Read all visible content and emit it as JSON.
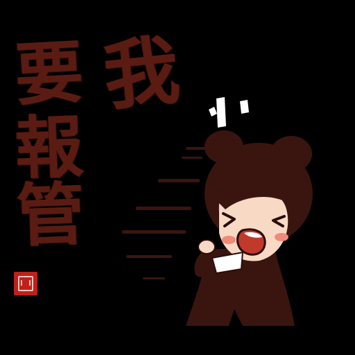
{
  "sticker": {
    "calligraphy": {
      "wo": "我",
      "yao": "要",
      "bao": "報",
      "guan": "管"
    },
    "colors": {
      "background": "#000000",
      "ink": "#5a1c12",
      "hair": "#3a1510",
      "skin": "#f7d9c4",
      "blush": "#f08a7a",
      "mouth": "#c0392b",
      "seal": "#c0201a",
      "white": "#ffffff"
    }
  }
}
